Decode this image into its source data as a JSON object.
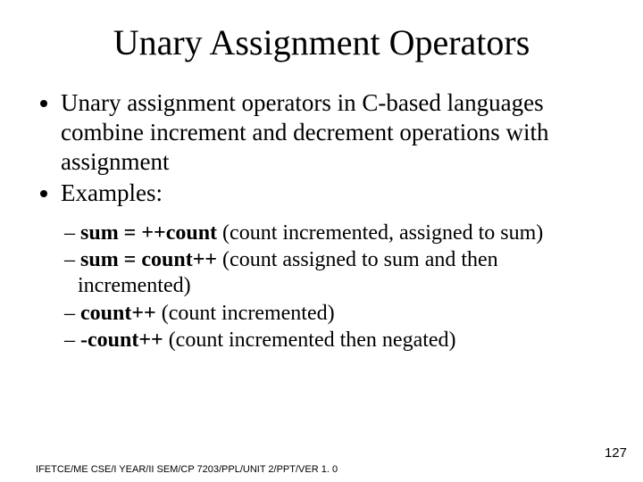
{
  "title": "Unary Assignment Operators",
  "bullets": [
    "Unary assignment operators in C-based languages combine increment and decrement operations with assignment",
    "Examples:"
  ],
  "sub": [
    {
      "code": "sum = ++count",
      "desc": " (count incremented, assigned to sum)"
    },
    {
      "code": "sum = count++",
      "desc": " (count assigned to sum and then incremented)"
    },
    {
      "code": "count++",
      "desc": " (count incremented)"
    },
    {
      "code": "-count++",
      "desc": " (count incremented then negated)"
    }
  ],
  "footer": "IFETCE/ME CSE/I YEAR/II SEM/CP 7203/PPL/UNIT 2/PPT/VER 1. 0",
  "page": "127",
  "dash": "– "
}
